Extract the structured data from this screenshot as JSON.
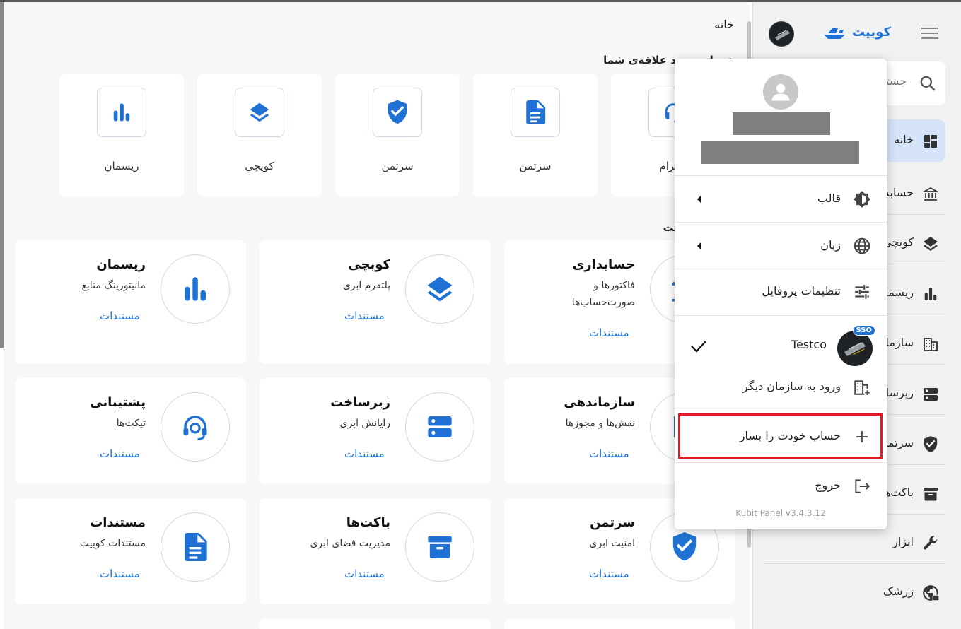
{
  "main": {
    "breadcrumb": "خانه",
    "favorites_title": "خدمات مورد علاقه‌ی شما",
    "services_title": "خدمات کوبیت",
    "favorites": [
      {
        "label": "تلگرام",
        "icon": "headset-icon"
      },
      {
        "label": "سرتمن",
        "icon": "document-icon"
      },
      {
        "label": "سرتمن",
        "icon": "shield-check-icon"
      },
      {
        "label": "کوپچی",
        "icon": "layers-icon"
      },
      {
        "label": "ریسمان",
        "icon": "bar-chart-icon"
      }
    ],
    "services": [
      {
        "title": "حسابداری",
        "desc": "فاکتورها و صورت‌حساب‌ها",
        "link": "مستندات",
        "icon": "accounting-icon"
      },
      {
        "title": "کوبچی",
        "desc": "پلتفرم ابری",
        "link": "مستندات",
        "icon": "layers-icon"
      },
      {
        "title": "ریسمان",
        "desc": "مانیتورینگ منابع",
        "link": "مستندات",
        "icon": "bar-chart-icon"
      },
      {
        "title": "سازماندهی",
        "desc": "نقش‌ها و مجوزها",
        "link": "مستندات",
        "icon": "org-icon"
      },
      {
        "title": "زیرساخت",
        "desc": "رایانش ابری",
        "link": "مستندات",
        "icon": "server-icon"
      },
      {
        "title": "پشتیبانی",
        "desc": "تیکت‌ها",
        "link": "مستندات",
        "icon": "headset-icon"
      },
      {
        "title": "سرتمن",
        "desc": "امنیت ابری",
        "link": "مستندات",
        "icon": "shield-check-icon"
      },
      {
        "title": "باکت‌ها",
        "desc": "مدیریت فضای ابری",
        "link": "مستندات",
        "icon": "archive-icon"
      },
      {
        "title": "مستندات",
        "desc": "مستندات کوبیت",
        "link": "مستندات",
        "icon": "document-icon"
      }
    ]
  },
  "sidebar": {
    "brand": "کوبیت",
    "search_placeholder": "جستجو",
    "items": [
      {
        "label": "خانه",
        "icon": "dashboard-icon"
      },
      {
        "label": "حسابداری",
        "icon": "bank-icon"
      },
      {
        "label": "کوبچی",
        "icon": "layers-icon"
      },
      {
        "label": "ریسمان",
        "icon": "bar-chart-icon"
      },
      {
        "label": "سازماندهی",
        "icon": "building-icon"
      },
      {
        "label": "زیرساخت",
        "icon": "server-icon"
      },
      {
        "label": "سرتمن",
        "icon": "shield-check-icon"
      },
      {
        "label": "باکت‌ها",
        "icon": "archive-icon"
      },
      {
        "label": "ابزار",
        "icon": "wrench-icon"
      },
      {
        "label": "زرشک",
        "icon": "globe-lock-icon"
      }
    ]
  },
  "menu": {
    "theme": "قالب",
    "language": "زبان",
    "profile_settings": "تنظیمات پروفایل",
    "org_name": "Testco",
    "sso_badge": "SSO",
    "other_org": "ورود به سازمان دیگر",
    "create_account": "حساب خودت را بساز",
    "logout": "خروج",
    "version": "Kubit Panel v3.4.3.12"
  },
  "colors": {
    "accent": "#1f72d3",
    "active_bg": "#d6e4f9",
    "highlight": "#e31b23"
  }
}
